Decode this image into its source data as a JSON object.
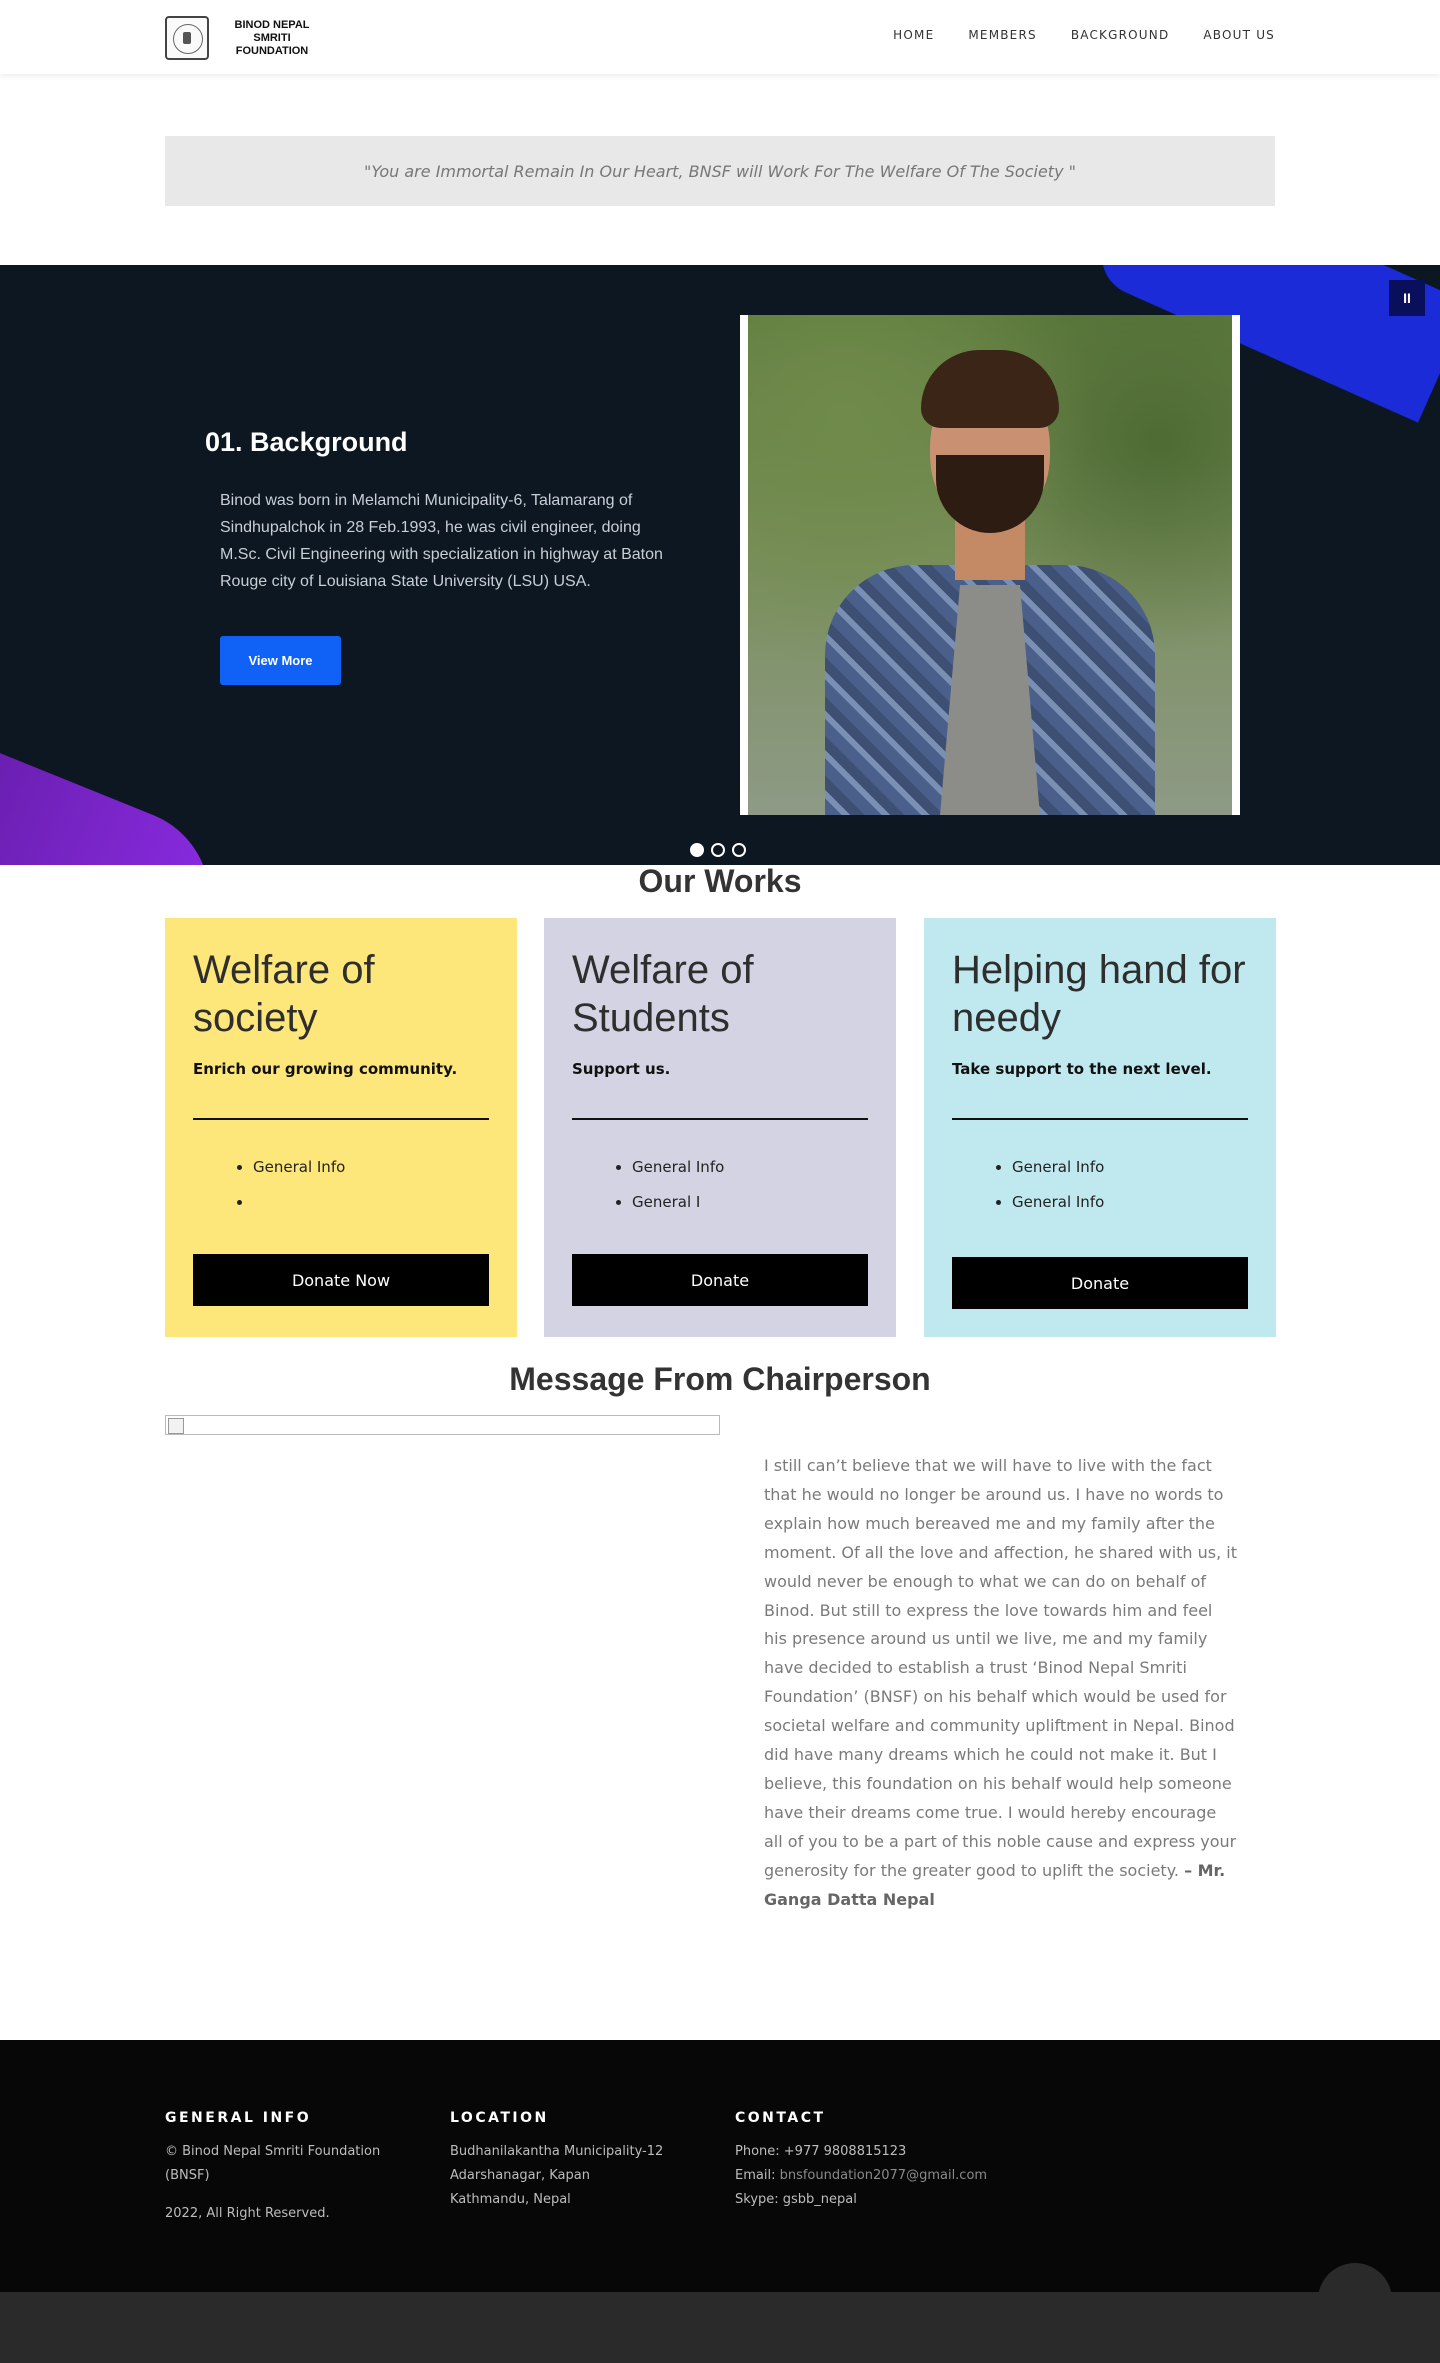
{
  "header": {
    "logo_text": "BINOD NEPAL SMRITI FOUNDATION",
    "nav": [
      "HOME",
      "MEMBERS",
      "BACKGROUND",
      "ABOUT US"
    ]
  },
  "quote": "\"You are Immortal Remain In Our Heart, BNSF will Work For The Welfare Of The Society \"",
  "slider": {
    "pause_label": "II",
    "title": "01. Background",
    "text": "Binod was born in Melamchi Municipality-6, Talamarang of Sindhupalchok in 28 Feb.1993, he was civil engineer, doing M.Sc. Civil Engineering with specialization in highway at Baton Rouge city of Louisiana State University (LSU) USA.",
    "button": "View More",
    "slide_count": 3,
    "active_slide": 1
  },
  "works": {
    "title": "Our Works",
    "cards": [
      {
        "heading": "Welfare of society",
        "subtitle": "Enrich our growing community.",
        "items": [
          "General Info",
          ""
        ],
        "button": "Donate Now",
        "color": "#fde67a"
      },
      {
        "heading": "Welfare of Students",
        "subtitle": "Support us.",
        "items": [
          "General Info",
          "General I"
        ],
        "button": "Donate",
        "color": "#d4d3e3"
      },
      {
        "heading": "Helping hand for needy",
        "subtitle": "Take support to the next level.",
        "items": [
          "General Info",
          "General Info"
        ],
        "button": "Donate",
        "color": "#c0e9ef"
      }
    ]
  },
  "message": {
    "title": "Message From Chairperson",
    "text": "I still can’t believe that we will have to live with the fact that he would no longer be around us. I have no words to explain how much bereaved me and my family after the moment. Of all the love and affection, he shared with us, it would never be enough to what we can do on behalf of Binod. But still to express the love towards him and feel his presence around us until we live, me and my family have decided to establish a trust ‘Binod Nepal Smriti Foundation’ (BNSF) on his behalf which would be used for societal welfare and community upliftment in Nepal. Binod did have many dreams which he could not make it. But I believe, this foundation on his behalf would help someone have their dreams come true. I would hereby encourage all of you to be a part of this noble cause and express your generosity for the greater good to uplift the society. ",
    "signature": "– Mr. Ganga Datta Nepal"
  },
  "footer": {
    "general": {
      "heading": "GENERAL INFO",
      "line1": "© Binod Nepal Smriti Foundation (BNSF)",
      "line2": "2022, All Right Reserved."
    },
    "location": {
      "heading": "LOCATION",
      "line1": "Budhanilakantha Municipality-12",
      "line2": "Adarshanagar, Kapan",
      "line3": "Kathmandu, Nepal"
    },
    "contact": {
      "heading": "CONTACT",
      "phone": "Phone: +977 9808815123",
      "email_label": "Email: ",
      "email": "bnsfoundation2077@gmail.com",
      "skype": "Skype: gsbb_nepal"
    }
  },
  "colors": {
    "slider_bg": "#0c1722",
    "accent_blue": "#0f62f5",
    "blob_blue": "#1b2bd8",
    "blob_purple": "#8a2be2",
    "footer_bg": "#070707"
  }
}
